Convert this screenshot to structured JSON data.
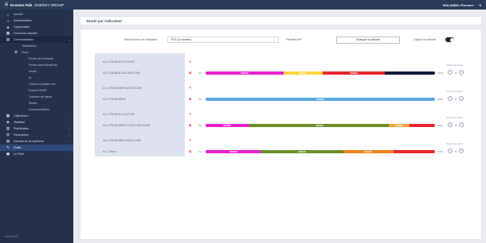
{
  "topbar": {
    "app_name": "Ecosmo Pub",
    "org": "ENERGY GROUP",
    "user": "MALANDIL Florence",
    "logout_icon": "logout-icon"
  },
  "sidebar": {
    "items": [
      {
        "icon": "home-icon",
        "label": "Accueil",
        "chevron": "‹"
      },
      {
        "icon": "admin-icon",
        "label": "Administration",
        "chevron": "‹"
      },
      {
        "icon": "org-icon",
        "label": "Organisation",
        "chevron": "‹"
      },
      {
        "icon": "calendar-icon",
        "label": "Ouverture chantier",
        "chevron": "‹"
      },
      {
        "icon": "grid-icon",
        "label": "Communication",
        "chevron": "⌄"
      }
    ],
    "sub_items": [
      "Webinaires",
      "Liens",
      "Fiches de Contacts",
      "Fiches des indicateurs",
      "Seuils",
      "IA",
      "Tutoriels youtube ent.",
      "Doctos ENOP",
      "Tutoriels de saisie",
      "Mixtes",
      "Documentations"
    ],
    "items2": [
      {
        "icon": "calendar-icon",
        "label": "Calendriers",
        "chevron": "‹"
      },
      {
        "icon": "shield-icon",
        "label": "Vitalitiest",
        "chevron": "‹"
      },
      {
        "icon": "chart-icon",
        "label": "Planification",
        "chevron": "‹"
      },
      {
        "icon": "gear-icon",
        "label": "Paramètres",
        "chevron": "‹"
      },
      {
        "icon": "stats-icon",
        "label": "Indicateurs de synthèse",
        "chevron": "‹"
      },
      {
        "icon": "wrench-icon",
        "label": "Outils",
        "chevron": "‹"
      },
      {
        "icon": "print-icon",
        "label": "Le Point",
        "chevron": "‹"
      }
    ],
    "version": "v4.34.0022"
  },
  "page": {
    "title": "Seuils par indicateur"
  },
  "filters": {
    "label": "Sélectionner un indicateur",
    "indicator_value": "TPO (1e année)",
    "period": "Période MIP",
    "button": "Changer la période",
    "toggle_label": "Cliquer la période",
    "toggle_on": true
  },
  "rows": [
    {
      "name": "ALL-ETB-BENCH-SOLVES",
      "type": "plus"
    },
    {
      "name": "ALL-ETB-BENCH-BLANK-ITEM",
      "type": "bar",
      "pct_left": "0%",
      "pct_right": "100%",
      "ctrl_title": "Nombre de Seuils",
      "count": "4",
      "segments": [
        {
          "color": "#e91ecf",
          "pct": 34
        },
        {
          "color": "#ffd43b",
          "pct": 17
        },
        {
          "color": "#e8262d",
          "pct": 27
        },
        {
          "color": "#0b1a3a",
          "pct": 22
        }
      ]
    },
    {
      "name": "ALL-ETB-MEMBRE-BENCH-AXE",
      "type": "plus"
    },
    {
      "name": "ALL-ETB-MEMBRE",
      "type": "bar",
      "pct_left": "0%",
      "pct_right": "100%",
      "ctrl_title": "Nombre de Seuils",
      "count": "2",
      "segments": [
        {
          "color": "#5aa9e6",
          "pct": 100
        }
      ]
    },
    {
      "name": "ALL-ETB-BENCH-AXE-BIS",
      "type": "plus"
    },
    {
      "name": "ALL-ETB-MEMBRE-FORCE-ENCHAINE",
      "type": "bar",
      "pct_left": "0%",
      "pct_right": "100%",
      "ctrl_title": "Nombre de Seuils",
      "count": "4",
      "segments": [
        {
          "color": "#e91ecf",
          "pct": 19
        },
        {
          "color": "#6b8e23",
          "pct": 61
        },
        {
          "color": "#f3a33b",
          "pct": 9
        },
        {
          "color": "#e8262d",
          "pct": 11
        }
      ]
    },
    {
      "name": "ALL-ETB-MEMBRE-BENCH-BIS",
      "type": "plus"
    },
    {
      "name": "ALL-Thème",
      "type": "bar",
      "pct_left": "0%",
      "pct_right": "100%",
      "ctrl_title": "Nombre de Seuils",
      "count": "4",
      "segments": [
        {
          "color": "#e91ecf",
          "pct": 24
        },
        {
          "color": "#6b8e23",
          "pct": 36
        },
        {
          "color": "#f3801a",
          "pct": 22
        },
        {
          "color": "#e8262d",
          "pct": 18
        }
      ]
    }
  ]
}
